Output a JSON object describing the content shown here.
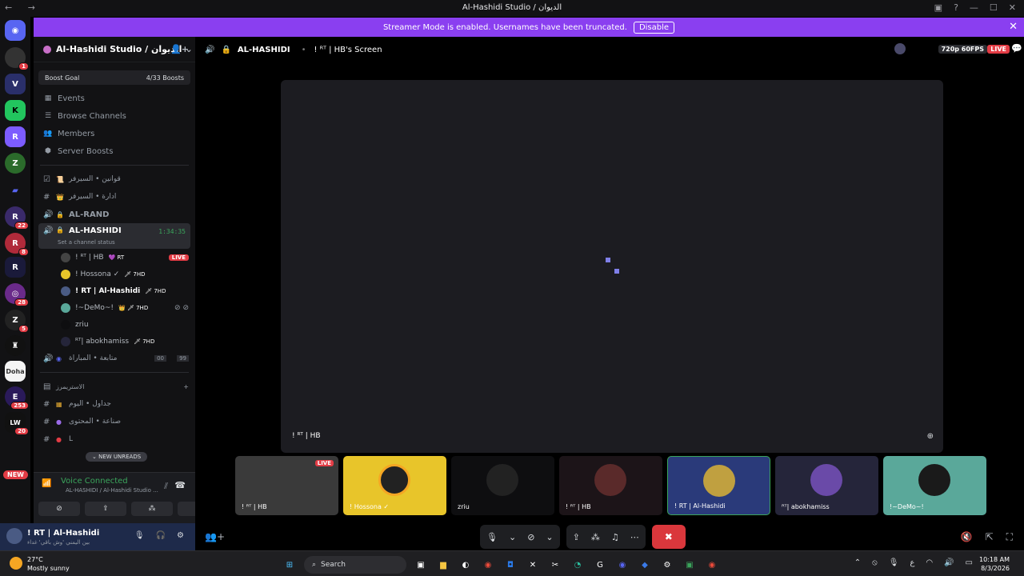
{
  "window": {
    "title": "Al-Hashidi Studio / الديوان",
    "nav": "← →",
    "icons": [
      "inbox-icon",
      "help-icon",
      "minimize-icon",
      "maximize-icon",
      "close-icon"
    ]
  },
  "banner": {
    "text": "Streamer Mode is enabled. Usernames have been truncated.",
    "button": "Disable",
    "close": "✕"
  },
  "guilds": {
    "badges": [
      "1",
      "22",
      "8",
      "28",
      "5",
      "253",
      "20"
    ],
    "new_label": "NEW"
  },
  "server": {
    "name": "Al-Hashidi Studio / الديوان",
    "boost_label": "Boost Goal",
    "boost_progress": "4/33 Boosts"
  },
  "menu": [
    {
      "icon": "▦",
      "label": "Events"
    },
    {
      "icon": "☰",
      "label": "Browse Channels"
    },
    {
      "icon": "👥",
      "label": "Members"
    },
    {
      "icon": "⬢",
      "label": "Server Boosts"
    }
  ],
  "channels": {
    "c1": "قوانين • السيرفر",
    "c2": "ادارة • السيرفر",
    "c3": "AL-RAND",
    "active": "AL-HASHIDI",
    "timer": "1:34:35",
    "status": "Set a channel status",
    "c4": "متابعة • المباراة",
    "c4_count_a": "00",
    "c4_count_b": "99",
    "category": "الاستريمرز",
    "c5": "جداول • اليوم",
    "c6": "صناعة • المحتوى",
    "c7": "L"
  },
  "voice_users": [
    {
      "name": "! ᴿᵀ | HB",
      "tag": "💜 RT",
      "live": "LIVE"
    },
    {
      "name": "! Hossona ✓",
      "tag": "🗡 7HD"
    },
    {
      "name": "! RT | Al-Hashidi",
      "tag": "🗡 7HD"
    },
    {
      "name": "!~DeMo~!",
      "tag": "👑 🗡 7HD"
    },
    {
      "name": "zriu",
      "tag": ""
    },
    {
      "name": "ᴿᵀ| abokhamiss",
      "tag": "🗡 7HD"
    }
  ],
  "new_unreads": "NEW UNREADS",
  "voice_panel": {
    "status": "Voice Connected",
    "detail": "AL-HASHIDI / Al-Hashidi Studio ..."
  },
  "user": {
    "name": "! RT | Al-Hashidi",
    "sub": "بين اليمني 'وش باقي' غداء"
  },
  "stream_header": {
    "channel": "AL-HASHIDI",
    "screen": "! ᴿᵀ | HB's Screen",
    "quality": "720p 60FPS",
    "live": "LIVE"
  },
  "stage_label": "! ᴿᵀ | HB",
  "tiles": [
    {
      "name": "! ᴿᵀ | HB",
      "live": "LIVE",
      "bg": "#3a3a3a"
    },
    {
      "name": "! Hossona ✓",
      "bg": "#e8c52a"
    },
    {
      "name": "zriu",
      "bg": "#0e0e10"
    },
    {
      "name": "! ᴿᵀ | HB",
      "bg": "#1c1418"
    },
    {
      "name": "! RT | Al-Hashidi",
      "bg": "#2a3a7a"
    },
    {
      "name": "ᴿᵀ| abokhamiss",
      "bg": "#25253a"
    },
    {
      "name": "!~DeMo~!",
      "bg": "#5aa89a"
    }
  ],
  "taskbar": {
    "temp": "27°C",
    "weather": "Mostly sunny",
    "search": "Search",
    "time": "10:18 AM",
    "date": "8/3/2026",
    "lang": "ع"
  },
  "colors": {
    "accent": "#8a3ff0",
    "live": "#e33c45",
    "connected": "#3ba55c"
  }
}
